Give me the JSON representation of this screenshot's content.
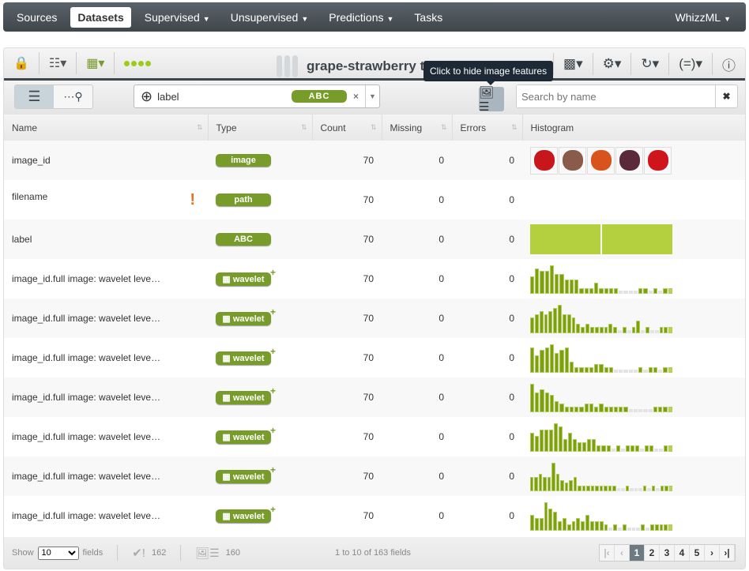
{
  "nav": {
    "items": [
      {
        "label": "Sources"
      },
      {
        "label": "Datasets",
        "active": true
      },
      {
        "label": "Supervised",
        "caret": true
      },
      {
        "label": "Unsupervised",
        "caret": true
      },
      {
        "label": "Predictions",
        "caret": true
      },
      {
        "label": "Tasks"
      }
    ],
    "user": "WhizzML"
  },
  "toolbar": {
    "title": "grape-strawberry texture",
    "tooltip": "Click to hide image features",
    "filter_value": "label",
    "filter_type": "ABC",
    "search_placeholder": "Search by name"
  },
  "table": {
    "columns": [
      "Name",
      "Type",
      "Count",
      "Missing",
      "Errors",
      "Histogram"
    ],
    "rows": [
      {
        "name": "image_id",
        "type": "image",
        "count": "70",
        "missing": "0",
        "errors": "0",
        "hist": "images"
      },
      {
        "name": "filename",
        "type": "path",
        "count": "70",
        "missing": "0",
        "errors": "0",
        "warning": "!",
        "hist": "none"
      },
      {
        "name": "label",
        "type": "ABC",
        "count": "70",
        "missing": "0",
        "errors": "0",
        "hist": "categorical",
        "categories": 2
      },
      {
        "name": "image_id.full image: wavelet leve…",
        "type": "wavelet",
        "count": "70",
        "missing": "0",
        "errors": "0",
        "hist": [
          6,
          9,
          8,
          8,
          10,
          7,
          7,
          5,
          5,
          5,
          2,
          2,
          2,
          4,
          2,
          2,
          2,
          2,
          0,
          0,
          0,
          0,
          2,
          2,
          0,
          2,
          0,
          2,
          2
        ]
      },
      {
        "name": "image_id.full image: wavelet leve…",
        "type": "wavelet",
        "count": "70",
        "missing": "0",
        "errors": "0",
        "hist": [
          5,
          6,
          7,
          6,
          7,
          8,
          9,
          6,
          6,
          5,
          3,
          2,
          3,
          2,
          2,
          2,
          2,
          3,
          2,
          0,
          2,
          0,
          2,
          4,
          0,
          2,
          0,
          0,
          2,
          2,
          2
        ]
      },
      {
        "name": "image_id.full image: wavelet leve…",
        "type": "wavelet",
        "count": "70",
        "missing": "0",
        "errors": "0",
        "hist": [
          9,
          6,
          8,
          9,
          10,
          7,
          8,
          9,
          4,
          2,
          2,
          2,
          2,
          3,
          3,
          2,
          2,
          0,
          0,
          0,
          0,
          0,
          2,
          0,
          2,
          2,
          0,
          2,
          2
        ]
      },
      {
        "name": "image_id.full image: wavelet leve…",
        "type": "wavelet",
        "count": "70",
        "missing": "0",
        "errors": "0",
        "hist": [
          10,
          7,
          8,
          7,
          6,
          4,
          3,
          2,
          2,
          2,
          2,
          3,
          3,
          2,
          3,
          2,
          2,
          2,
          2,
          2,
          0,
          0,
          0,
          0,
          0,
          2,
          2,
          2,
          2
        ]
      },
      {
        "name": "image_id.full image: wavelet leve…",
        "type": "wavelet",
        "count": "70",
        "missing": "0",
        "errors": "0",
        "hist": [
          6,
          5,
          7,
          7,
          7,
          9,
          8,
          4,
          6,
          4,
          3,
          3,
          4,
          4,
          2,
          2,
          2,
          0,
          2,
          0,
          2,
          2,
          2,
          0,
          2,
          2,
          0,
          0,
          2,
          2
        ]
      },
      {
        "name": "image_id.full image: wavelet leve…",
        "type": "wavelet",
        "count": "70",
        "missing": "0",
        "errors": "0",
        "hist": [
          5,
          5,
          6,
          5,
          5,
          10,
          6,
          4,
          3,
          4,
          5,
          2,
          2,
          2,
          2,
          2,
          2,
          2,
          2,
          2,
          0,
          0,
          2,
          0,
          0,
          0,
          2,
          0,
          2,
          0,
          2,
          2,
          2
        ]
      },
      {
        "name": "image_id.full image: wavelet leve…",
        "type": "wavelet",
        "count": "70",
        "missing": "0",
        "errors": "0",
        "hist": [
          5,
          4,
          4,
          9,
          7,
          6,
          3,
          4,
          2,
          3,
          4,
          3,
          5,
          3,
          3,
          3,
          2,
          0,
          2,
          0,
          2,
          0,
          0,
          0,
          2,
          0,
          2,
          2,
          2,
          2,
          2
        ]
      }
    ]
  },
  "footer": {
    "show_label": "Show",
    "show_value": "10",
    "fields_label": "fields",
    "valid_count": "162",
    "image_count": "160",
    "range": "1 to 10 of 163 fields",
    "pages": [
      "1",
      "2",
      "3",
      "4",
      "5"
    ],
    "current_page": "1"
  },
  "colors": {
    "accent": "#779c2a",
    "histogram": "#7da10c",
    "warning": "#e8721a",
    "nav": "#4a5157"
  }
}
